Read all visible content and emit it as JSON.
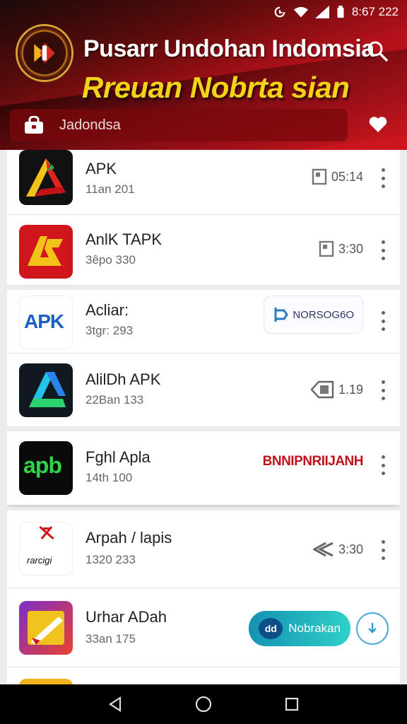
{
  "status": {
    "time": "8:67 222"
  },
  "header": {
    "title": "Pusarr Undohan Indomsia",
    "subtitle": "Rreuan Nobrta sian",
    "search_placeholder": "Jadondsa",
    "brand_color": "#c8141d",
    "accent_color": "#f3d21a"
  },
  "apps": [
    {
      "name": "APK",
      "meta": "11an 201",
      "action": "05:14",
      "action_icon": "page-icon"
    },
    {
      "name": "AnlK TAPK",
      "meta": "3êpo 330",
      "action": "3:30",
      "action_icon": "page-icon"
    },
    {
      "name": "Acliar:",
      "meta": "3tgr: 293",
      "action": "NORSOG6O",
      "action_icon": "tag-icon"
    },
    {
      "name": "AlilDh APK",
      "meta": "22Ban 133",
      "action": "1.19",
      "action_icon": "label-icon"
    },
    {
      "name": "Fghl Apla",
      "meta": "14th 100",
      "action": "BNNIPNRIIJANH",
      "action_icon": ""
    },
    {
      "name": "Arpah / lapis",
      "meta": "1320 233",
      "action": "3:30",
      "action_icon": "back-icon"
    },
    {
      "name": "Urhar ADah",
      "meta": "33an 175",
      "action": "Nobrakan",
      "action_icon": "download-icon"
    }
  ],
  "icon_labels": {
    "apk_text": "APK",
    "apb_text": "apb",
    "ranig_text": "rarcigi",
    "dd_text": "dd"
  },
  "navbar": {
    "items": [
      "back-icon",
      "home-icon",
      "recents-icon"
    ]
  }
}
